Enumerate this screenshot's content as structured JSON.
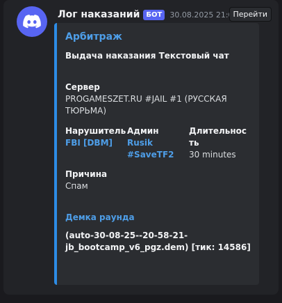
{
  "message": {
    "username": "Лог наказаний",
    "badge": "БОТ",
    "timestamp": "30.08.2025 21:02",
    "goto_label": "Перейти",
    "avatar_icon": "discord-logo-icon",
    "accent_color": "#5865f2"
  },
  "embed": {
    "title": "Арбитраж",
    "description": "Выдача наказания Текстовый чат",
    "bar_color": "#2d8ce6",
    "server": {
      "name": "Сервер",
      "value": "PROGAMESZET.RU #JAIL #1 (РУССКАЯ ТЮРЬМА)"
    },
    "offender": {
      "name": "Нарушитель",
      "value": "FBI [DBM]"
    },
    "admin": {
      "name": "Админ",
      "value": "Rusik #SaveTF2"
    },
    "duration": {
      "name": "Длительность",
      "value": "30 minutes"
    },
    "reason": {
      "name": "Причина",
      "value": "Спам"
    },
    "demo": {
      "title": "Демка раунда",
      "value": "(auto-30-08-25--20-58-21-jb_bootcamp_v6_pgz.dem) [тик: 14586]"
    }
  }
}
